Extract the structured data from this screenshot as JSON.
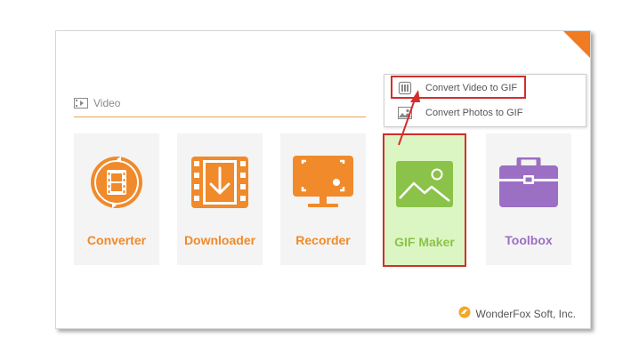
{
  "section": {
    "title": "Video",
    "icon": "film-strip-icon"
  },
  "tiles": [
    {
      "label": "Converter",
      "icon": "converter-film-icon"
    },
    {
      "label": "Downloader",
      "icon": "downloader-film-icon"
    },
    {
      "label": "Recorder",
      "icon": "recorder-monitor-icon"
    },
    {
      "label": "GIF Maker",
      "icon": "gif-image-icon"
    },
    {
      "label": "Toolbox",
      "icon": "toolbox-icon"
    }
  ],
  "dropdown": {
    "items": [
      {
        "label": "Convert Video to GIF",
        "icon": "video-icon"
      },
      {
        "label": "Convert Photos to GIF",
        "icon": "photo-icon"
      }
    ]
  },
  "footer": {
    "brand": "WonderFox Soft, Inc.",
    "icon": "wonderfox-logo-icon"
  },
  "colors": {
    "accent_orange": "#f08a2a",
    "gif_green": "#8bc34a",
    "gif_bg": "#dcf6c3",
    "toolbox_purple": "#9b6fc4",
    "highlight_red": "#d32d2d"
  }
}
